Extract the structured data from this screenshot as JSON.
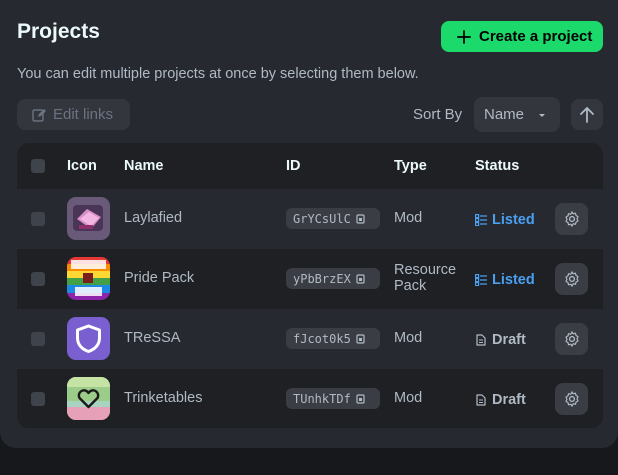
{
  "header": {
    "title": "Projects",
    "create_label": "Create a project",
    "subtitle": "You can edit multiple projects at once by selecting them below."
  },
  "toolbar": {
    "edit_links_label": "Edit links",
    "sort_by_label": "Sort By",
    "sort_value": "Name"
  },
  "table": {
    "columns": [
      "Icon",
      "Name",
      "ID",
      "Type",
      "Status"
    ],
    "rows": [
      {
        "name": "Laylafied",
        "id": "GrYCsUlC",
        "type": "Mod",
        "status": "Listed"
      },
      {
        "name": "Pride Pack",
        "id": "yPbBrzEX",
        "type": "Resource Pack",
        "status": "Listed"
      },
      {
        "name": "TReSSA",
        "id": "fJcot0k5",
        "type": "Mod",
        "status": "Draft"
      },
      {
        "name": "Trinketables",
        "id": "TUnhkTDf",
        "type": "Mod",
        "status": "Draft"
      }
    ]
  },
  "colors": {
    "accent": "#1bd96a",
    "listed": "#4a9ff0",
    "draft": "#b0bac5"
  }
}
